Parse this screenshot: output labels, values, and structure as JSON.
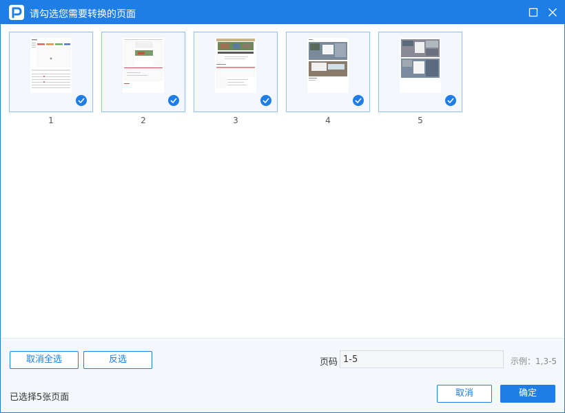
{
  "window": {
    "title": "请勾选您需要转换的页面",
    "accent_color": "#1e7ee6",
    "controls": [
      "maximize-icon",
      "close-icon"
    ]
  },
  "thumbnails": [
    {
      "number": "1",
      "selected": true
    },
    {
      "number": "2",
      "selected": true
    },
    {
      "number": "3",
      "selected": true
    },
    {
      "number": "4",
      "selected": true
    },
    {
      "number": "5",
      "selected": true
    }
  ],
  "footer": {
    "deselect_all_label": "取消全选",
    "invert_label": "反选",
    "page_label": "页码",
    "page_range_value": "1-5",
    "example_hint": "示例：1,3-5",
    "status_text": "已选择5张页面",
    "cancel_label": "取消",
    "confirm_label": "确定"
  }
}
